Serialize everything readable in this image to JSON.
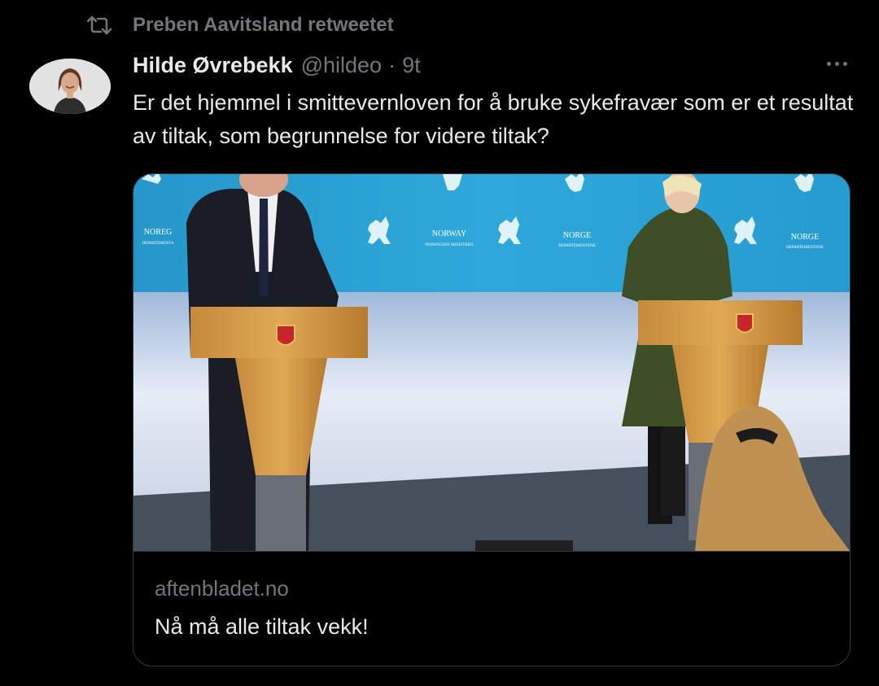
{
  "retweet": {
    "label": "Preben Aavitsland retweetet",
    "icon": "retweet-icon"
  },
  "author": {
    "name": "Hilde Øvrebekk",
    "handle": "@hildeo",
    "separator": "·",
    "time": "9t",
    "avatar": "avatar-photo"
  },
  "tweet": {
    "text": "Er det hjemmel i smittevernloven for å bruke sykefravær som er et resultat av tiltak, som begrunnelse for videre tiltak?"
  },
  "card": {
    "domain": "aftenbladet.no",
    "title": "Nå må alle tiltak vekk!",
    "image": "press-conference-photo",
    "backdrop_labels": [
      "NOREG",
      "DEPARTEMENTA",
      "NORWAY",
      "NORWEGIAN MINISTRIES",
      "NORGE",
      "DEPARTEMENTENE",
      "NORGE",
      "DEPARTEMENTENE"
    ]
  },
  "more_icon": "more-options-icon",
  "colors": {
    "background": "#000000",
    "text": "#e7e9ea",
    "secondary": "#71767b",
    "border": "#333639",
    "backdrop_blue": "#2aa3d6"
  }
}
